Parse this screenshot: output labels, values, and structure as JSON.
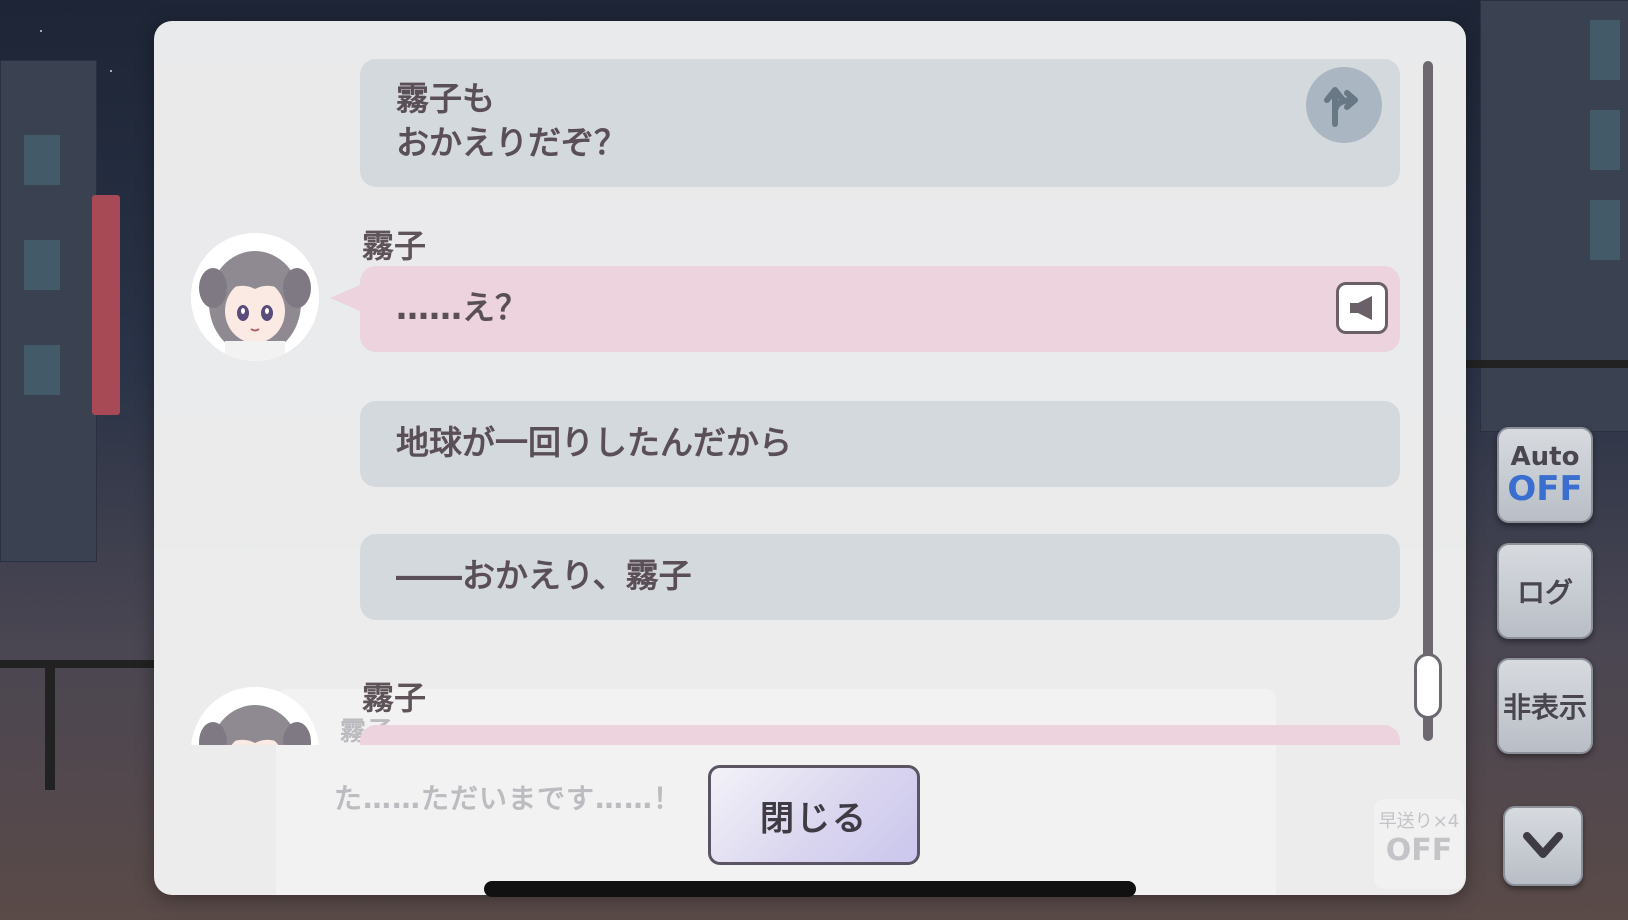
{
  "log": {
    "entries": [
      {
        "type": "narration",
        "lines": [
          "霧子も",
          "おかえりだぞ？"
        ],
        "icon": "branch-choice-icon"
      },
      {
        "type": "speech",
        "speaker": "霧子",
        "lines": [
          "……え？"
        ],
        "icon": "voice-play-icon"
      },
      {
        "type": "narration",
        "lines": [
          "地球が一回りしたんだから"
        ]
      },
      {
        "type": "narration",
        "lines": [
          "――おかえり、霧子"
        ]
      },
      {
        "type": "speech",
        "speaker": "霧子",
        "lines": [
          ""
        ]
      }
    ],
    "close_label": "閉じる"
  },
  "background": {
    "dialog_text": "た……ただいまです……！",
    "speaker_ghost": "霧子",
    "fast_forward_label": "早送り×4",
    "fast_forward_state": "OFF"
  },
  "side_controls": {
    "auto_label": "Auto",
    "auto_state": "OFF",
    "log_label": "ログ",
    "hide_label": "非表示",
    "scroll_down_icon": "chevron-down-icon"
  },
  "colors": {
    "narration_bubble": "#d4d9de",
    "speech_bubble": "#ecd3dd",
    "auto_off_accent": "#3a6fd0"
  }
}
